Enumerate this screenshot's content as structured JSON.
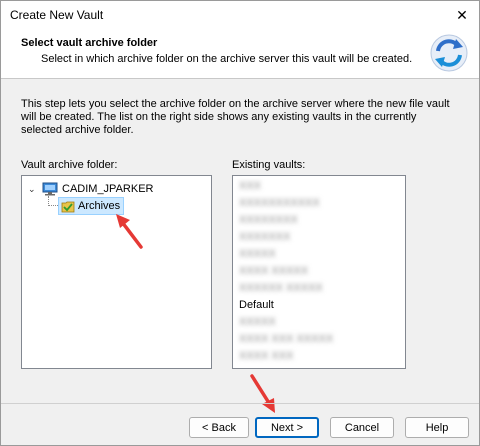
{
  "window": {
    "title": "Create New Vault",
    "close_glyph": "✕"
  },
  "header": {
    "title": "Select vault archive folder",
    "subtitle": "Select in which archive folder on the archive server this vault will be created.",
    "icon": "refresh-arrows-icon"
  },
  "description": "This step lets you select the archive folder on the archive server where the new file vault will be created. The list on the right side shows any existing vaults in the currently selected archive folder.",
  "left_panel": {
    "label": "Vault archive folder:",
    "tree": {
      "root": {
        "label": "CADIM_JPARKER",
        "expanded": true,
        "icon": "computer-icon"
      },
      "children": [
        {
          "label": "Archives",
          "selected": true,
          "icon": "folder-icon"
        }
      ]
    }
  },
  "right_panel": {
    "label": "Existing vaults:",
    "items": [
      {
        "label": "XXX",
        "obscured": true
      },
      {
        "label": "XXXXXXXXXXX",
        "obscured": true
      },
      {
        "label": "XXXXXXXX",
        "obscured": true
      },
      {
        "label": "XXXXXXX",
        "obscured": true
      },
      {
        "label": "XXXXX",
        "obscured": true
      },
      {
        "label": "XXXX XXXXX",
        "obscured": true
      },
      {
        "label": "XXXXXX XXXXX",
        "obscured": true
      },
      {
        "label": "Default",
        "obscured": false
      },
      {
        "label": "XXXXX",
        "obscured": true
      },
      {
        "label": "XXXX XXX XXXXX",
        "obscured": true
      },
      {
        "label": "XXXX XXX",
        "obscured": true
      }
    ]
  },
  "buttons": {
    "back": "< Back",
    "next": "Next >",
    "cancel": "Cancel",
    "help": "Help"
  },
  "colors": {
    "selection_bg": "#cce8ff",
    "primary_border": "#0067c0",
    "annotation_arrow": "#e53935"
  }
}
